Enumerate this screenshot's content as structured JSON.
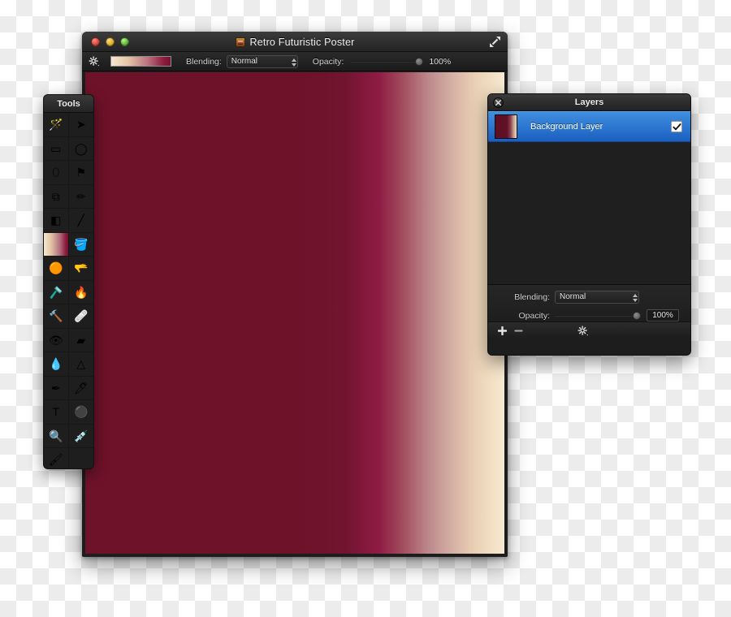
{
  "document_window": {
    "title": "Retro Futuristic Poster",
    "title_icon": "image-document-icon",
    "expand_icon": "expand-arrows-icon",
    "traffic_lights": [
      {
        "name": "close",
        "color": "#d0402f"
      },
      {
        "name": "minimize",
        "color": "#d9a321"
      },
      {
        "name": "zoom",
        "color": "#4faa2d"
      }
    ],
    "toolbar": {
      "settings_icon": "gear-icon",
      "gradient_swatch": "gradient-swatch",
      "blending_label": "Blending:",
      "blending_value": "Normal",
      "opacity_label": "Opacity:",
      "opacity_value": "100%"
    },
    "canvas": {
      "gradient_from": "#6e1229",
      "gradient_to": "#f6e8d2"
    }
  },
  "tools_panel": {
    "title": "Tools",
    "tools": [
      {
        "name": "magic-wand-tool",
        "glyph": "🪄",
        "selected": false
      },
      {
        "name": "move-tool",
        "glyph": "➤",
        "selected": false
      },
      {
        "name": "rectangular-marquee-tool",
        "glyph": "▭",
        "selected": false
      },
      {
        "name": "elliptical-marquee-tool",
        "glyph": "◯",
        "selected": false
      },
      {
        "name": "lasso-tool",
        "glyph": "⬯",
        "selected": false
      },
      {
        "name": "polygonal-lasso-tool",
        "glyph": "⚑",
        "selected": false
      },
      {
        "name": "crop-tool",
        "glyph": "⧉",
        "selected": false
      },
      {
        "name": "pencil-tool",
        "glyph": "✏",
        "selected": false
      },
      {
        "name": "eraser-tool",
        "glyph": "◧",
        "selected": false
      },
      {
        "name": "brush-tool",
        "glyph": "╱",
        "selected": false
      },
      {
        "name": "gradient-tool",
        "glyph": "",
        "selected": true
      },
      {
        "name": "paint-bucket-tool",
        "glyph": "🪣",
        "selected": false
      },
      {
        "name": "dodge-tool",
        "glyph": "🟠",
        "selected": false
      },
      {
        "name": "burn-tool",
        "glyph": "🫳",
        "selected": false
      },
      {
        "name": "blur-tool",
        "glyph": "🪒",
        "selected": false
      },
      {
        "name": "flame-tool",
        "glyph": "🔥",
        "selected": false
      },
      {
        "name": "clone-stamp-tool",
        "glyph": "🔨",
        "selected": false
      },
      {
        "name": "bandage-tool",
        "glyph": "🩹",
        "selected": false
      },
      {
        "name": "red-eye-tool",
        "glyph": "👁",
        "selected": false
      },
      {
        "name": "eraser-block-tool",
        "glyph": "▰",
        "selected": false
      },
      {
        "name": "water-drop-tool",
        "glyph": "💧",
        "selected": false
      },
      {
        "name": "sharpen-cone-tool",
        "glyph": "△",
        "selected": false
      },
      {
        "name": "pen-tool",
        "glyph": "✒",
        "selected": false
      },
      {
        "name": "ink-pen-tool",
        "glyph": "🖊",
        "selected": false
      },
      {
        "name": "type-tool",
        "glyph": "T",
        "selected": false
      },
      {
        "name": "shape-ellipse-tool",
        "glyph": "⚫",
        "selected": false
      },
      {
        "name": "zoom-tool",
        "glyph": "🔍",
        "selected": false
      },
      {
        "name": "eyedropper-tool",
        "glyph": "💉",
        "selected": false
      },
      {
        "name": "paintbrush-tool",
        "glyph": "🖌",
        "selected": false
      }
    ]
  },
  "layers_panel": {
    "title": "Layers",
    "close_icon": "close-icon",
    "layers": [
      {
        "name": "Background Layer",
        "visible": true,
        "selected": true,
        "check_glyph": "✔"
      }
    ],
    "blending_label": "Blending:",
    "blending_value": "Normal",
    "opacity_label": "Opacity:",
    "opacity_value": "100%",
    "footer": {
      "add_icon": "plus-icon",
      "remove_icon": "minus-icon",
      "settings_icon": "gear-icon"
    }
  }
}
